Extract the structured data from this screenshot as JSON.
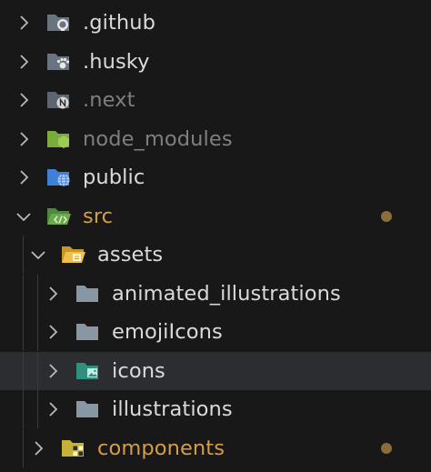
{
  "explorer": {
    "items": [
      {
        "label": ".github",
        "icon": "github-folder-icon",
        "expanded": false
      },
      {
        "label": ".husky",
        "icon": "husky-folder-icon",
        "expanded": false
      },
      {
        "label": ".next",
        "icon": "next-folder-icon",
        "expanded": false
      },
      {
        "label": "node_modules",
        "icon": "node-modules-folder-icon",
        "expanded": false
      },
      {
        "label": "public",
        "icon": "public-folder-icon",
        "expanded": false
      },
      {
        "label": "src",
        "icon": "src-folder-icon",
        "expanded": true,
        "modified": true
      },
      {
        "label": "assets",
        "icon": "assets-folder-open-icon",
        "expanded": true
      },
      {
        "label": "animated_illustrations",
        "icon": "folder-icon",
        "expanded": false
      },
      {
        "label": "emojiIcons",
        "icon": "folder-icon",
        "expanded": false
      },
      {
        "label": "icons",
        "icon": "images-folder-icon",
        "expanded": false,
        "selected": true
      },
      {
        "label": "illustrations",
        "icon": "folder-icon",
        "expanded": false
      },
      {
        "label": "components",
        "icon": "components-folder-icon",
        "expanded": false,
        "modified": true
      }
    ]
  },
  "colors": {
    "background": "#181818",
    "selected_row": "#2b2d31",
    "text": "#dadada",
    "ignored_text": "#7f7f7f",
    "modified_text": "#d69d45",
    "modified_dot": "#8a6d3b"
  }
}
